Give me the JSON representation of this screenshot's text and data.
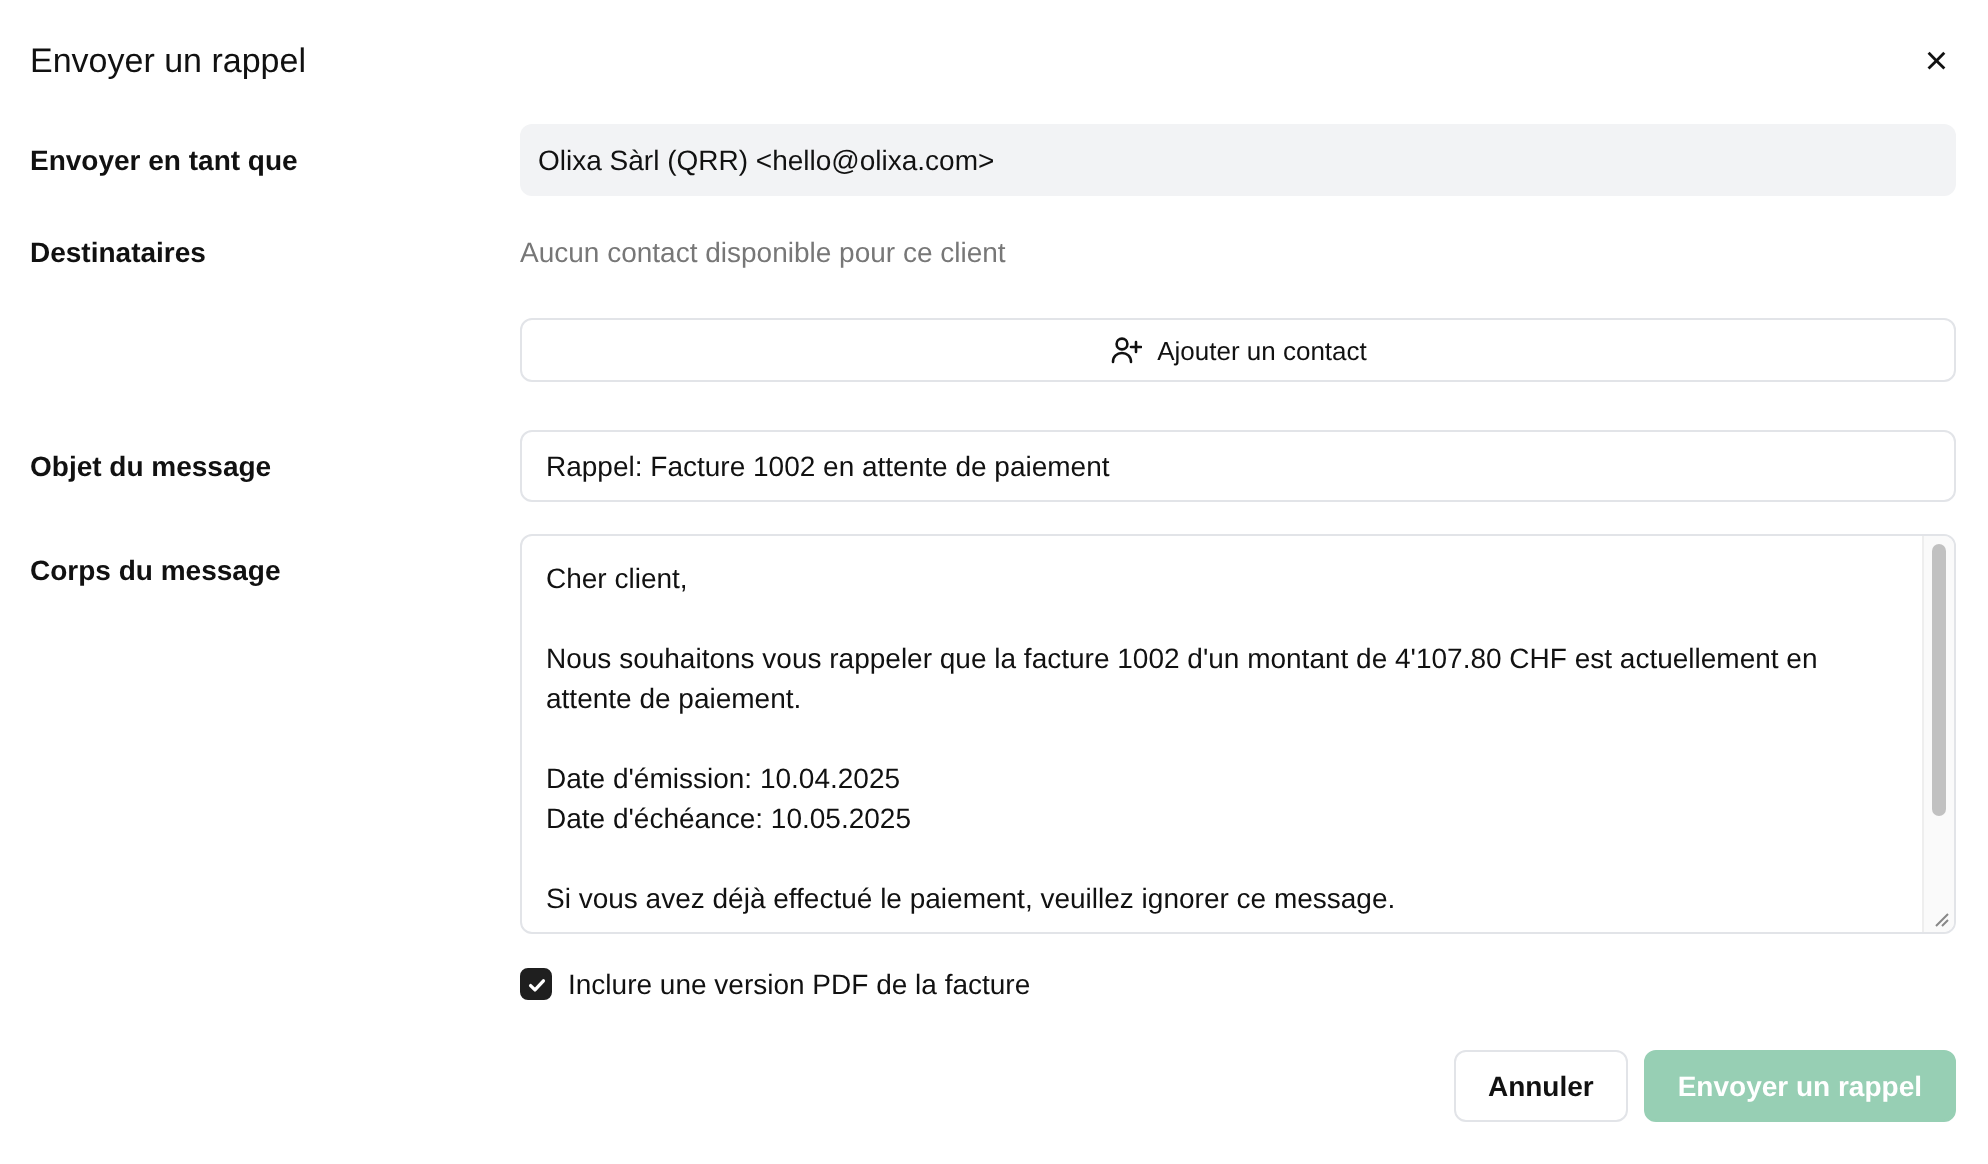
{
  "dialog": {
    "title": "Envoyer un rappel",
    "close": "×"
  },
  "sender": {
    "label": "Envoyer en tant que",
    "value": "Olixa Sàrl (QRR) <hello@olixa.com>",
    "disabled": true
  },
  "recipients": {
    "label": "Destinataires",
    "empty_text": "Aucun contact disponible pour ce client",
    "add_button": "Ajouter un contact"
  },
  "subject": {
    "label": "Objet du message",
    "value": "Rappel: Facture 1002 en attente de paiement"
  },
  "body": {
    "label": "Corps du message",
    "paragraphs": [
      {
        "lines": [
          "Cher client,"
        ]
      },
      {
        "lines": [
          "Nous souhaitons vous rappeler que la facture 1002 d'un montant de 4'107.80 CHF est actuellement en attente de paiement."
        ]
      },
      {
        "lines": [
          "Date d'émission: 10.04.2025",
          "Date d'échéance: 10.05.2025"
        ]
      },
      {
        "lines": [
          "Si vous avez déjà effectué le paiement, veuillez ignorer ce message."
        ]
      }
    ]
  },
  "attach_pdf": {
    "label": "Inclure une version PDF de la facture",
    "checked": true
  },
  "buttons": [
    {
      "label": "Annuler",
      "kind": "secondary",
      "disabled": false
    },
    {
      "label": "Envoyer un rappel",
      "kind": "primary",
      "disabled": true
    }
  ]
}
